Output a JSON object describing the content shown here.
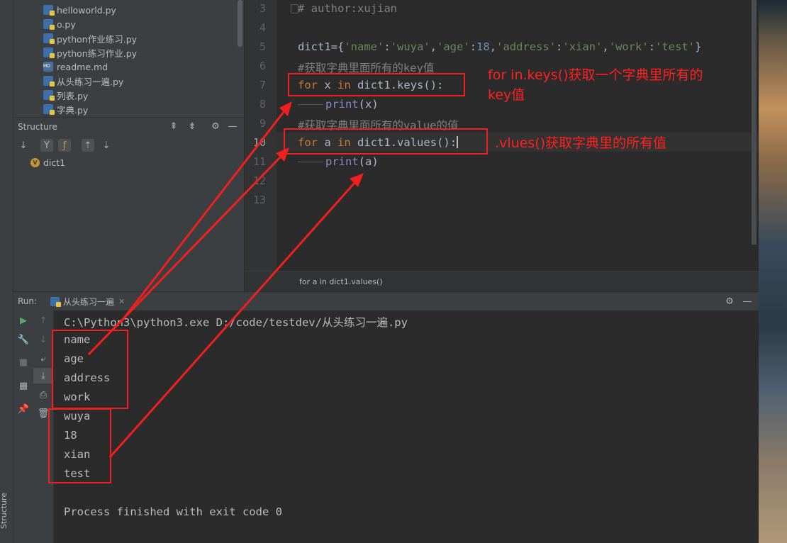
{
  "project_tree": {
    "files": [
      {
        "name": "helloworld.py",
        "type": "py"
      },
      {
        "name": "o.py",
        "type": "py"
      },
      {
        "name": "python作业练习.py",
        "type": "py"
      },
      {
        "name": "python练习作业.py",
        "type": "py"
      },
      {
        "name": "readme.md",
        "type": "md"
      },
      {
        "name": "从头练习一遍.py",
        "type": "py"
      },
      {
        "name": "列表.py",
        "type": "py"
      },
      {
        "name": "字典.py",
        "type": "py"
      }
    ]
  },
  "structure": {
    "title": "Structure",
    "item_badge": "V",
    "item": "dict1"
  },
  "editor": {
    "line_numbers": [
      "3",
      "4",
      "5",
      "6",
      "7",
      "8",
      "9",
      "10",
      "11",
      "12",
      "13"
    ],
    "lines": {
      "l3": "# author:xujian",
      "l5_var": "dict1={",
      "l5_items": [
        {
          "k": "'name'",
          "v": "'wuya'",
          "num": false
        },
        {
          "k": "'age'",
          "v": "18",
          "num": true
        },
        {
          "k": "'address'",
          "v": "'xian'",
          "num": false
        },
        {
          "k": "'work'",
          "v": "'test'",
          "num": false
        }
      ],
      "l6": "#获取字典里面所有的key值",
      "l7_kw": "for",
      "l7_var": "x",
      "l7_in": "in",
      "l7_rest": "dict1.keys():",
      "l8_fn": "print",
      "l8_arg": "(x)",
      "l9": "#获取字典里面所有的value的值",
      "l10_kw": "for",
      "l10_var": "a",
      "l10_in": "in",
      "l10_rest": "dict1.values():",
      "l11_fn": "print",
      "l11_arg": "(a)"
    },
    "breadcrumb": "for a in dict1.values()"
  },
  "run": {
    "label": "Run:",
    "tab": "从头练习一遍",
    "command": "C:\\Python3\\python3.exe D:/code/testdev/从头练习一遍.py",
    "keys": [
      "name",
      "age",
      "address",
      "work"
    ],
    "values": [
      "wuya",
      "18",
      "xian",
      "test"
    ],
    "finish": "Process finished with exit code 0"
  },
  "annotations": {
    "keys_note_line1": "for in.keys()获取一个字典里所有的",
    "keys_note_line2": "key值",
    "values_note": ".vlues()获取字典里的所有值"
  },
  "colors": {
    "annotation_red": "#ff2020",
    "keyword": "#cc7832",
    "string": "#6a8759",
    "number": "#6897bb",
    "comment": "#808080"
  },
  "sidebar_vertical_label": "Structure"
}
